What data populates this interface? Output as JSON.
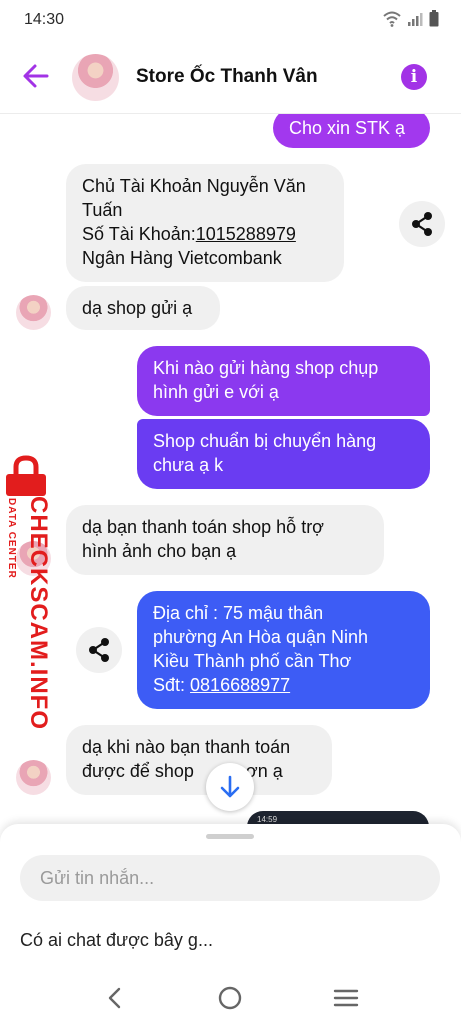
{
  "status_bar": {
    "time": "14:30"
  },
  "header": {
    "title": "Store Ốc Thanh Vân"
  },
  "messages": {
    "m1": {
      "text": "Cho xin STK ạ"
    },
    "m2": {
      "line1": "Chủ Tài Khoản Nguyễn Văn",
      "line2": "Tuấn",
      "line3_prefix": "Số Tài Khoản:",
      "account_number": "1015288979",
      "line4": "Ngân Hàng Vietcombank"
    },
    "m3": {
      "text": "dạ shop gửi ạ"
    },
    "m4": {
      "line1": "Khi nào gửi hàng shop chụp",
      "line2": "hình gửi e với ạ"
    },
    "m5": {
      "line1": "Shop chuẩn bị chuyển hàng",
      "line2": "chưa ạ k"
    },
    "m6": {
      "line1": "dạ bạn thanh toán shop hỗ trợ",
      "line2": "hình ảnh cho bạn ạ"
    },
    "m7": {
      "line1": "Địa chỉ : 75 mậu thân",
      "line2": "phường An Hòa quận Ninh",
      "line3": "Kiều Thành phố cần Thơ",
      "line4_prefix": "Sđt: ",
      "phone": "0816688977"
    },
    "m8": {
      "line1": "dạ khi nào bạn thanh toán",
      "line2": "được để shop",
      "line2_tail": "ơn ạ"
    },
    "thumbnail": {
      "time": "14:59"
    }
  },
  "watermark": {
    "brand": "CHECKSCAM.INFO",
    "sub": "DATA CENTER"
  },
  "composer": {
    "placeholder": "Gửi tin nhắn...",
    "suggestion": "Có ai chat được bây g..."
  },
  "colors": {
    "accent": "#a233e6",
    "bubble_in": "#f0f0f0",
    "gradient_top": "#a238ee",
    "gradient_mid": "#6a3cf2",
    "gradient_bottom": "#3d5cf5",
    "watermark": "#e21d1d"
  },
  "icons": {
    "back": "arrow-left-icon",
    "info": "info-icon",
    "share": "share-icon",
    "scroll_down": "arrow-down-icon",
    "nav_back": "chevron-left-icon",
    "nav_home": "circle-home-icon",
    "nav_recents": "menu-lines-icon"
  }
}
